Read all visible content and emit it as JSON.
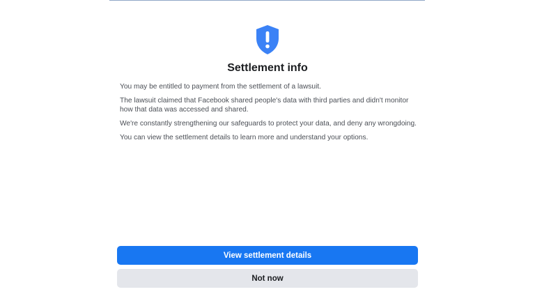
{
  "icon": "shield-exclamation-icon",
  "colors": {
    "accent": "#1877f2",
    "secondary_button": "#e4e6eb",
    "title_text": "#1c1e21",
    "body_text": "#4b4f56"
  },
  "dialog": {
    "title": "Settlement info",
    "paragraphs": [
      "You may be entitled to payment from the settlement of a lawsuit.",
      "The lawsuit claimed that Facebook shared people's data with third parties and didn't monitor how that data was accessed and shared.",
      "We're constantly strengthening our safeguards to protect your data, and deny any wrongdoing.",
      "You can view the settlement details to learn more and understand your options."
    ],
    "primary_button": "View settlement details",
    "secondary_button": "Not now"
  }
}
